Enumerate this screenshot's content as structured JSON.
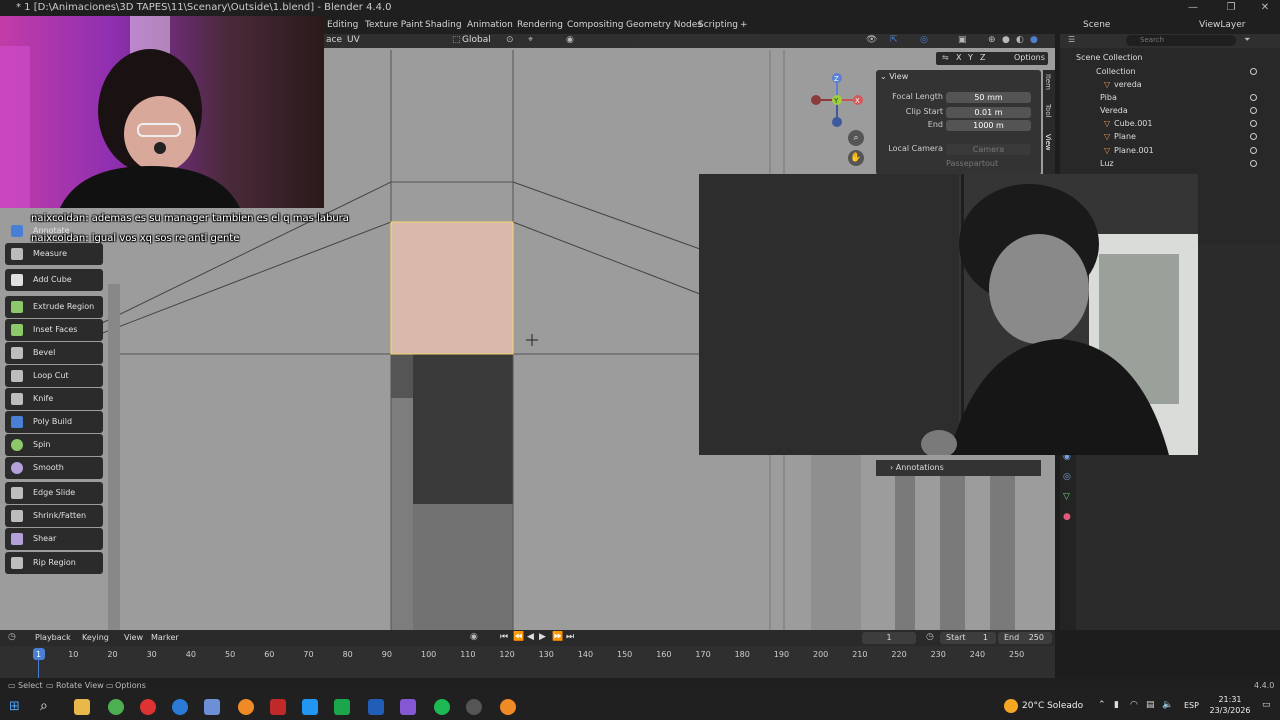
{
  "window": {
    "title": "* 1 [D:\\Animaciones\\3D TAPES\\11\\Scenary\\Outside\\1.blend] - Blender 4.4.0",
    "min": "—",
    "max": "❐",
    "close": "✕"
  },
  "workspaces": [
    "Editing",
    "Texture Paint",
    "Shading",
    "Animation",
    "Rendering",
    "Compositing",
    "Geometry Nodes",
    "Scripting",
    "+"
  ],
  "scene": {
    "label": "Scene",
    "viewlayer": "ViewLayer"
  },
  "viewport_header": {
    "mode_face": "ace",
    "uv": "UV",
    "transform": "Global",
    "options": "Options",
    "axes": [
      "X",
      "Y",
      "Z"
    ]
  },
  "chat": [
    {
      "name": "naixcoldan:",
      "msg": "ademas es su manager tambien es el q mas labura"
    },
    {
      "name": "naixcoldan:",
      "msg": "igual vos xq sos re anti gente"
    }
  ],
  "tools": [
    "Annotate",
    "Measure",
    "Add Cube",
    "Extrude Region",
    "Inset Faces",
    "Bevel",
    "Loop Cut",
    "Knife",
    "Poly Build",
    "Spin",
    "Smooth",
    "Edge Slide",
    "Shrink/Fatten",
    "Shear",
    "Rip Region"
  ],
  "gizmo": {
    "z": "Z",
    "y": "Y",
    "x": "X"
  },
  "n_panel": {
    "section": "View",
    "focal_length_label": "Focal Length",
    "focal_length": "50 mm",
    "clip_start_label": "Clip Start",
    "clip_start": "0.01 m",
    "end_label": "End",
    "end": "1000 m",
    "local_camera_label": "Local Camera",
    "camera": "Camera",
    "passepartout": "Passepartout",
    "tabs": [
      "Item",
      "Tool",
      "View"
    ],
    "annotations": "Annotations"
  },
  "outliner": {
    "search_placeholder": "Search",
    "items": [
      {
        "label": "Scene Collection",
        "indent": 0
      },
      {
        "label": "Collection",
        "indent": 1
      },
      {
        "label": "vereda",
        "indent": 2
      },
      {
        "label": "Piba",
        "indent": 1
      },
      {
        "label": "Vereda",
        "indent": 1
      },
      {
        "label": "Cube.001",
        "indent": 2
      },
      {
        "label": "Plane",
        "indent": 2
      },
      {
        "label": "Plane.001",
        "indent": 2
      },
      {
        "label": "Luz",
        "indent": 1
      }
    ]
  },
  "timeline": {
    "menus": [
      "Playback",
      "Keying",
      "View",
      "Marker"
    ],
    "current_frame": "1",
    "start_label": "Start",
    "start": "1",
    "end_label": "End",
    "end": "250",
    "ticks": [
      "1",
      "10",
      "20",
      "30",
      "40",
      "50",
      "60",
      "70",
      "80",
      "90",
      "100",
      "110",
      "120",
      "130",
      "140",
      "150",
      "160",
      "170",
      "180",
      "190",
      "200",
      "210",
      "220",
      "230",
      "240",
      "250"
    ]
  },
  "statusbar": {
    "select": "Select",
    "rotate": "Rotate View",
    "options": "Options",
    "version": "4.4.0"
  },
  "taskbar": {
    "weather": "20°C  Soleado",
    "lang": "ESP",
    "time": "21:31",
    "date": "23/3/2026"
  },
  "colors": {
    "selected_face": "#d9b9ab",
    "face_outline": "#f3d66e",
    "viewport_bg": "#9c9c9c",
    "accent_blue": "#4a7fd6"
  }
}
